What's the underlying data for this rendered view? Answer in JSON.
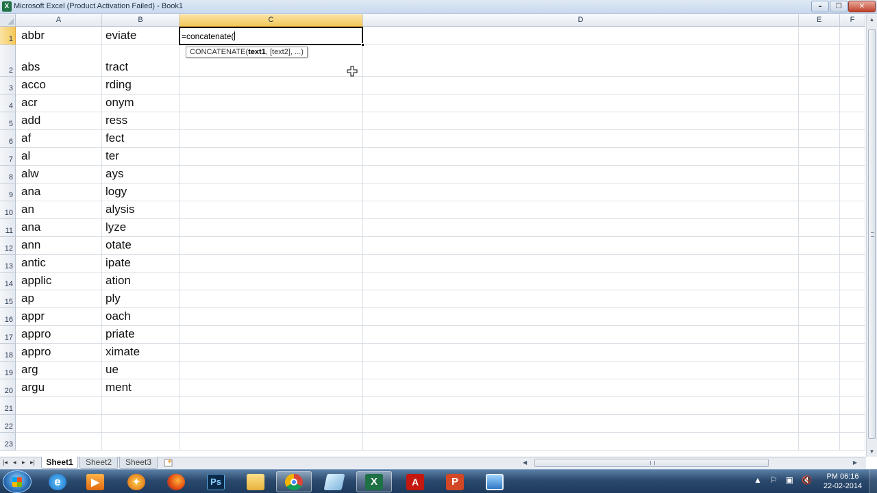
{
  "window": {
    "title": "Microsoft Excel (Product Activation Failed) - Book1",
    "app_icon": "X",
    "minimize": "–",
    "maximize": "❐",
    "close": "✕"
  },
  "columns": [
    "A",
    "B",
    "C",
    "D",
    "E",
    "F"
  ],
  "active_column": "C",
  "active_row": "1",
  "rows": [
    {
      "num": "1",
      "a": "abbr",
      "b": "eviate"
    },
    {
      "num": "2",
      "a": "abs",
      "b": "tract"
    },
    {
      "num": "3",
      "a": "acco",
      "b": "rding"
    },
    {
      "num": "4",
      "a": "acr",
      "b": "onym"
    },
    {
      "num": "5",
      "a": "add",
      "b": "ress"
    },
    {
      "num": "6",
      "a": "af",
      "b": "fect"
    },
    {
      "num": "7",
      "a": "al",
      "b": "ter"
    },
    {
      "num": "8",
      "a": "alw",
      "b": "ays"
    },
    {
      "num": "9",
      "a": "ana",
      "b": "logy"
    },
    {
      "num": "10",
      "a": "an",
      "b": "alysis"
    },
    {
      "num": "11",
      "a": "ana",
      "b": "lyze"
    },
    {
      "num": "12",
      "a": "ann",
      "b": "otate"
    },
    {
      "num": "13",
      "a": "antic",
      "b": "ipate"
    },
    {
      "num": "14",
      "a": "applic",
      "b": "ation"
    },
    {
      "num": "15",
      "a": "ap",
      "b": "ply"
    },
    {
      "num": "16",
      "a": "appr",
      "b": "oach"
    },
    {
      "num": "17",
      "a": "appro",
      "b": "priate"
    },
    {
      "num": "18",
      "a": "appro",
      "b": "ximate"
    },
    {
      "num": "19",
      "a": "arg",
      "b": "ue"
    },
    {
      "num": "20",
      "a": "argu",
      "b": "ment"
    },
    {
      "num": "21",
      "a": "",
      "b": ""
    },
    {
      "num": "22",
      "a": "",
      "b": ""
    },
    {
      "num": "23",
      "a": "",
      "b": ""
    }
  ],
  "active_cell": {
    "address": "C1",
    "edit_text": "=concatenate("
  },
  "tooltip": {
    "func": "CONCATENATE(",
    "arg1": "text1",
    "rest": ", [text2], ...)"
  },
  "sheet_tabs": {
    "nav": [
      "|◂",
      "◂",
      "▸",
      "▸|"
    ],
    "tabs": [
      "Sheet1",
      "Sheet2",
      "Sheet3"
    ],
    "active": "Sheet1"
  },
  "taskbar": {
    "icons": [
      "start-orb",
      "internet-explorer",
      "media-player",
      "firefox-alt",
      "firefox",
      "photoshop",
      "file-explorer",
      "chrome",
      "notepad",
      "excel",
      "acrobat",
      "powerpoint",
      "remote-desktop"
    ],
    "clock_time": "PM 06:16",
    "clock_date": "22-02-2014"
  }
}
